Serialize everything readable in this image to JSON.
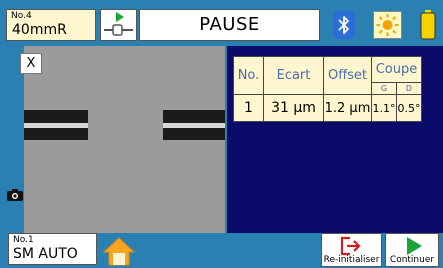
{
  "header": {
    "program_no": "No.4",
    "program_name": "40mmR",
    "status": "PAUSE"
  },
  "camera": {
    "close_label": "X"
  },
  "results": {
    "headers": {
      "no": "No.",
      "ecart": "Ecart",
      "offset": "Offset",
      "coupe": "Coupe",
      "g": "G",
      "d": "D"
    },
    "row": {
      "no": "1",
      "ecart": "31 µm",
      "offset": "1.2 µm",
      "g": "1.1°",
      "d": "0.5°"
    }
  },
  "footer": {
    "program_no": "No.1",
    "program_name": "SM AUTO",
    "reinit_label": "Re-initialiser",
    "continue_label": "Continuer"
  },
  "colors": {
    "background": "#2b80b2",
    "panel": "#0b0b6c",
    "table_bg": "#fdf6cf",
    "accent_green": "#1aa336",
    "accent_red": "#d21f1f"
  }
}
